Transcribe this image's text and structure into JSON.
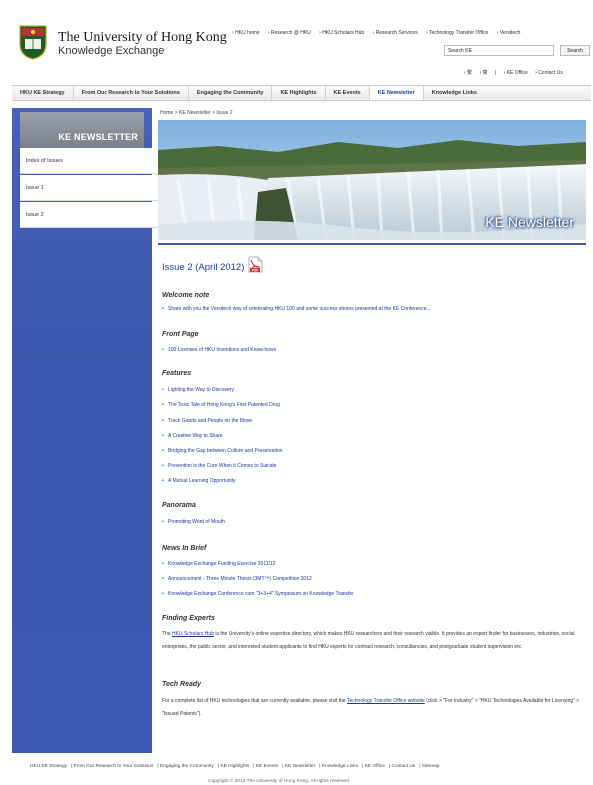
{
  "header": {
    "title": "The University of Hong Kong",
    "subtitle": "Knowledge Exchange",
    "top_links": [
      "HKU home",
      "Research @ HKU",
      "HKU Scholars Hub",
      "Research Services",
      "Technology Transfer Office",
      "Versitech"
    ],
    "search_value": "Search KE",
    "search_button": "Search",
    "util_links": [
      "繁",
      "简",
      "KE Office",
      "Contact Us"
    ]
  },
  "nav": {
    "items": [
      "HKU KE Strategy",
      "From Our Research to Your Solutions",
      "Engaging the Community",
      "KE Highlights",
      "KE Events",
      "KE Newsletter",
      "Knowledge Links"
    ]
  },
  "sidebar": {
    "heading": "KE NEWSLETTER",
    "items": [
      "Index of Issues",
      "Issue 1",
      "Issue 2"
    ]
  },
  "breadcrumb": "Home > KE Newsletter > Issue 2",
  "banner": {
    "caption": "KE Newsletter"
  },
  "issue": {
    "title": "Issue 2 (April 2012)",
    "pdf_icon": "pdf-icon"
  },
  "sections": {
    "welcome": {
      "heading": "Welcome note",
      "items": [
        "Share with you the Versitech way of celebrating HKU 100 and some success stories presented at the KE Conference..."
      ]
    },
    "front": {
      "heading": "Front Page",
      "items": [
        "100 Licenses of HKU Inventions and Know-hows"
      ]
    },
    "features": {
      "heading": "Features",
      "items": [
        "Lighting the Way to Discovery",
        "The Toxic Tale of Hong Kong's First Patented Drug",
        "Track Goods and People on the Move",
        "A Creative Way to Share",
        "Bridging the Gap between Culture and Preservation",
        "Prevention is the Cure When it Comes to Suicide",
        "A Mutual Learning Opportunity"
      ]
    },
    "panorama": {
      "heading": "Panorama",
      "items": [
        "Promoting Word of Mouth"
      ]
    },
    "news": {
      "heading": "News In Brief",
      "items": [
        "Knowledge Exchange Funding Exercise 2011/12",
        "Announcement - Three Minute Thesis (3MT™) Competition 2012",
        "Knowledge Exchange Conference cum \"3+3+4\" Symposium on Knowledge Transfer"
      ]
    },
    "experts": {
      "heading": "Finding Experts",
      "pre": "The ",
      "link": "HKU Scholars Hub",
      "post": " is the University's online expertise directory, which makes HKU researchers and their research visible. It provides an expert finder for businesses, industries, social enterprises, the public sector, and interested student applicants to find HKU experts for contract research, consultancies, and postgraduate student supervision etc."
    },
    "tech": {
      "heading": "Tech Ready",
      "pre": "For a complete list of HKU technologies that are currently available, please visit the ",
      "link": "Technology Transfer Office website",
      "post": " (click > \"For Industry\" > \"HKU Technologies Available for Licensing\" > \"Issued Patents\")."
    }
  },
  "footer": {
    "links": [
      "HKU KE Strategy",
      "From Our Research to Your Solutions",
      "Engaging the Community",
      "KE Highlights",
      "KE Events",
      "KE Newsletter",
      "Knowledge Links",
      "KE Office",
      "Contact Us",
      "Sitemap"
    ],
    "copyright": "Copyright © 2012 The University of Hong Kong. All rights reserved."
  },
  "colors": {
    "accent": "#3d59b0",
    "link": "#1c3a94",
    "sidebar": "#4862b8"
  }
}
